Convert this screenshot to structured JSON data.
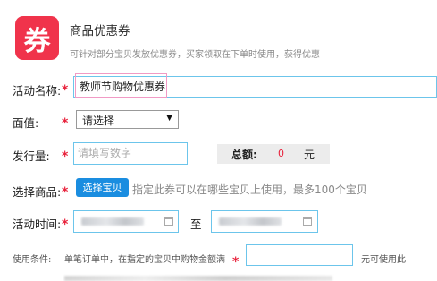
{
  "header": {
    "logo_char": "券",
    "title": "商品优惠券",
    "subtitle": "可针对部分宝贝发放优惠券，买家领取在下单时使用，获得优惠"
  },
  "form": {
    "required_mark": "*",
    "activity_name": {
      "label": "活动名称:",
      "value": "教师节购物优惠券"
    },
    "face_value": {
      "label": "面值:",
      "selected": "请选择",
      "arrow": "▼"
    },
    "quantity": {
      "label": "发行量:",
      "placeholder": "请填写数字"
    },
    "total": {
      "label": "总额:",
      "value": "0",
      "unit": "元"
    },
    "products": {
      "label": "选择商品:",
      "button": "选择宝贝",
      "hint": "指定此券可以在哪些宝贝上使用，最多100个宝贝"
    },
    "time": {
      "label": "活动时间:",
      "separator": "至"
    },
    "condition": {
      "label": "使用条件:",
      "prefix": "单笔订单中，在指定的宝贝中购物金额满",
      "suffix": "元可使用此"
    }
  },
  "colors": {
    "accent": "#1a8de0",
    "required": "#e8203a",
    "brand": "#f0334b"
  }
}
